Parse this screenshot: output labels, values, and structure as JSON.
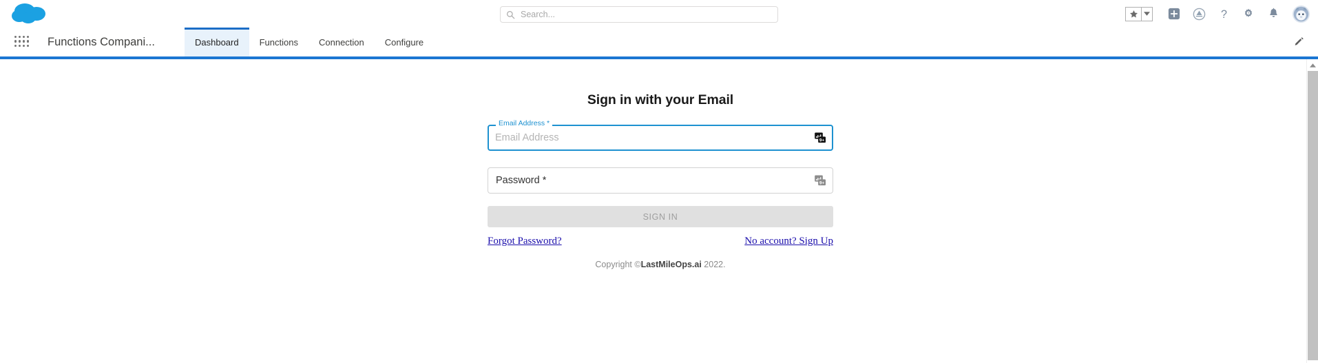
{
  "global_bar": {
    "logo": "salesforce-cloud-logo",
    "search": {
      "placeholder": "Search...",
      "value": "",
      "icon": "search-icon"
    },
    "actions": [
      {
        "name": "favorites-star",
        "icon": "star-icon",
        "label": "Favorites"
      },
      {
        "name": "favorites-caret",
        "icon": "chevron-down-icon",
        "label": "Favorites list"
      },
      {
        "name": "new-item",
        "icon": "plus-square-icon",
        "label": "New"
      },
      {
        "name": "learning",
        "icon": "trailhead-icon",
        "label": "Trailhead"
      },
      {
        "name": "help",
        "icon": "question-mark-icon",
        "label": "Help"
      },
      {
        "name": "setup",
        "icon": "gear-icon",
        "label": "Setup"
      },
      {
        "name": "notifications",
        "icon": "bell-icon",
        "label": "Notifications"
      },
      {
        "name": "user-avatar",
        "icon": "astro-avatar-icon",
        "label": "User"
      }
    ]
  },
  "app_nav": {
    "app_launcher_icon": "waffle-grid-icon",
    "app_name": "Functions Compani...",
    "tabs": [
      {
        "label": "Dashboard",
        "active": true
      },
      {
        "label": "Functions",
        "active": false
      },
      {
        "label": "Connection",
        "active": false
      },
      {
        "label": "Configure",
        "active": false
      }
    ],
    "edit_icon": "pencil-icon",
    "accent_color": "#1b76d2"
  },
  "login": {
    "title": "Sign in with your Email",
    "email": {
      "legend": "Email Address *",
      "placeholder": "Email Address",
      "value": "",
      "focused": true,
      "autofill_icon": "autofill-icon"
    },
    "password": {
      "label": "Password *",
      "value": "",
      "focused": false,
      "autofill_icon": "autofill-icon"
    },
    "submit_label": "SIGN IN",
    "forgot_password_label": "Forgot Password?",
    "signup_label": "No account? Sign Up",
    "copyright_prefix": "Copyright ©",
    "copyright_brand": "LastMileOps.ai",
    "copyright_year": " 2022."
  },
  "scrollbar": {
    "up_arrow_icon": "caret-up-icon"
  },
  "colors": {
    "brand_blue": "#1b76d2",
    "cloud_blue": "#1ba1e2",
    "focus_blue": "#1d91d0",
    "link_blue": "#1a0dab",
    "active_tab_bg": "#e8f2fb"
  }
}
